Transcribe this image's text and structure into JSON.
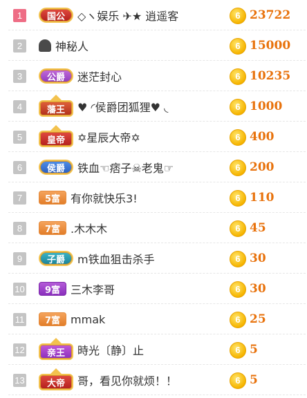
{
  "rows": [
    {
      "rank": "1",
      "badge": "国公",
      "badge_type": "b-guogong",
      "name": "◇ヽ娱乐 ✈★ 逍遥客",
      "score": "23722"
    },
    {
      "rank": "2",
      "badge": "",
      "badge_type": "",
      "name": "神秘人",
      "score": "15000",
      "avatar": true
    },
    {
      "rank": "3",
      "badge": "公爵",
      "badge_type": "b-gongjue",
      "name": "迷茫封心",
      "score": "10235"
    },
    {
      "rank": "4",
      "badge": "藩王",
      "badge_type": "b-fanwang crown",
      "name": "♥ ◜侯爵团狐狸♥ ◟",
      "score": "1000"
    },
    {
      "rank": "5",
      "badge": "皇帝",
      "badge_type": "b-huangdi crown",
      "name": "✡星辰大帝✡",
      "score": "400"
    },
    {
      "rank": "6",
      "badge": "侯爵",
      "badge_type": "b-houjue",
      "name": "铁血☜痞子☠老鬼☞",
      "score": "200"
    },
    {
      "rank": "7",
      "badge": "5富",
      "badge_type": "fu fu5",
      "name": "有你就快乐3!",
      "score": "110"
    },
    {
      "rank": "8",
      "badge": "7富",
      "badge_type": "fu fu7",
      "name": ".木木木",
      "score": "45"
    },
    {
      "rank": "9",
      "badge": "子爵",
      "badge_type": "b-zijue",
      "name": "m铁血狙击杀手",
      "score": "30"
    },
    {
      "rank": "10",
      "badge": "9富",
      "badge_type": "fu fu9",
      "name": "三木李哥",
      "score": "30"
    },
    {
      "rank": "11",
      "badge": "7富",
      "badge_type": "fu fu7",
      "name": "mmak",
      "score": "25"
    },
    {
      "rank": "12",
      "badge": "亲王",
      "badge_type": "b-qinwang crown",
      "name": "時光〔静〕止",
      "score": "5"
    },
    {
      "rank": "13",
      "badge": "大帝",
      "badge_type": "b-dadi crown",
      "name": "哥，看见你就烦！！",
      "score": "5"
    }
  ],
  "coin_label": "6",
  "colors": {
    "score": "#e8720c",
    "rank_first": "#ee6d85",
    "rank_other": "#c4c4c4"
  }
}
